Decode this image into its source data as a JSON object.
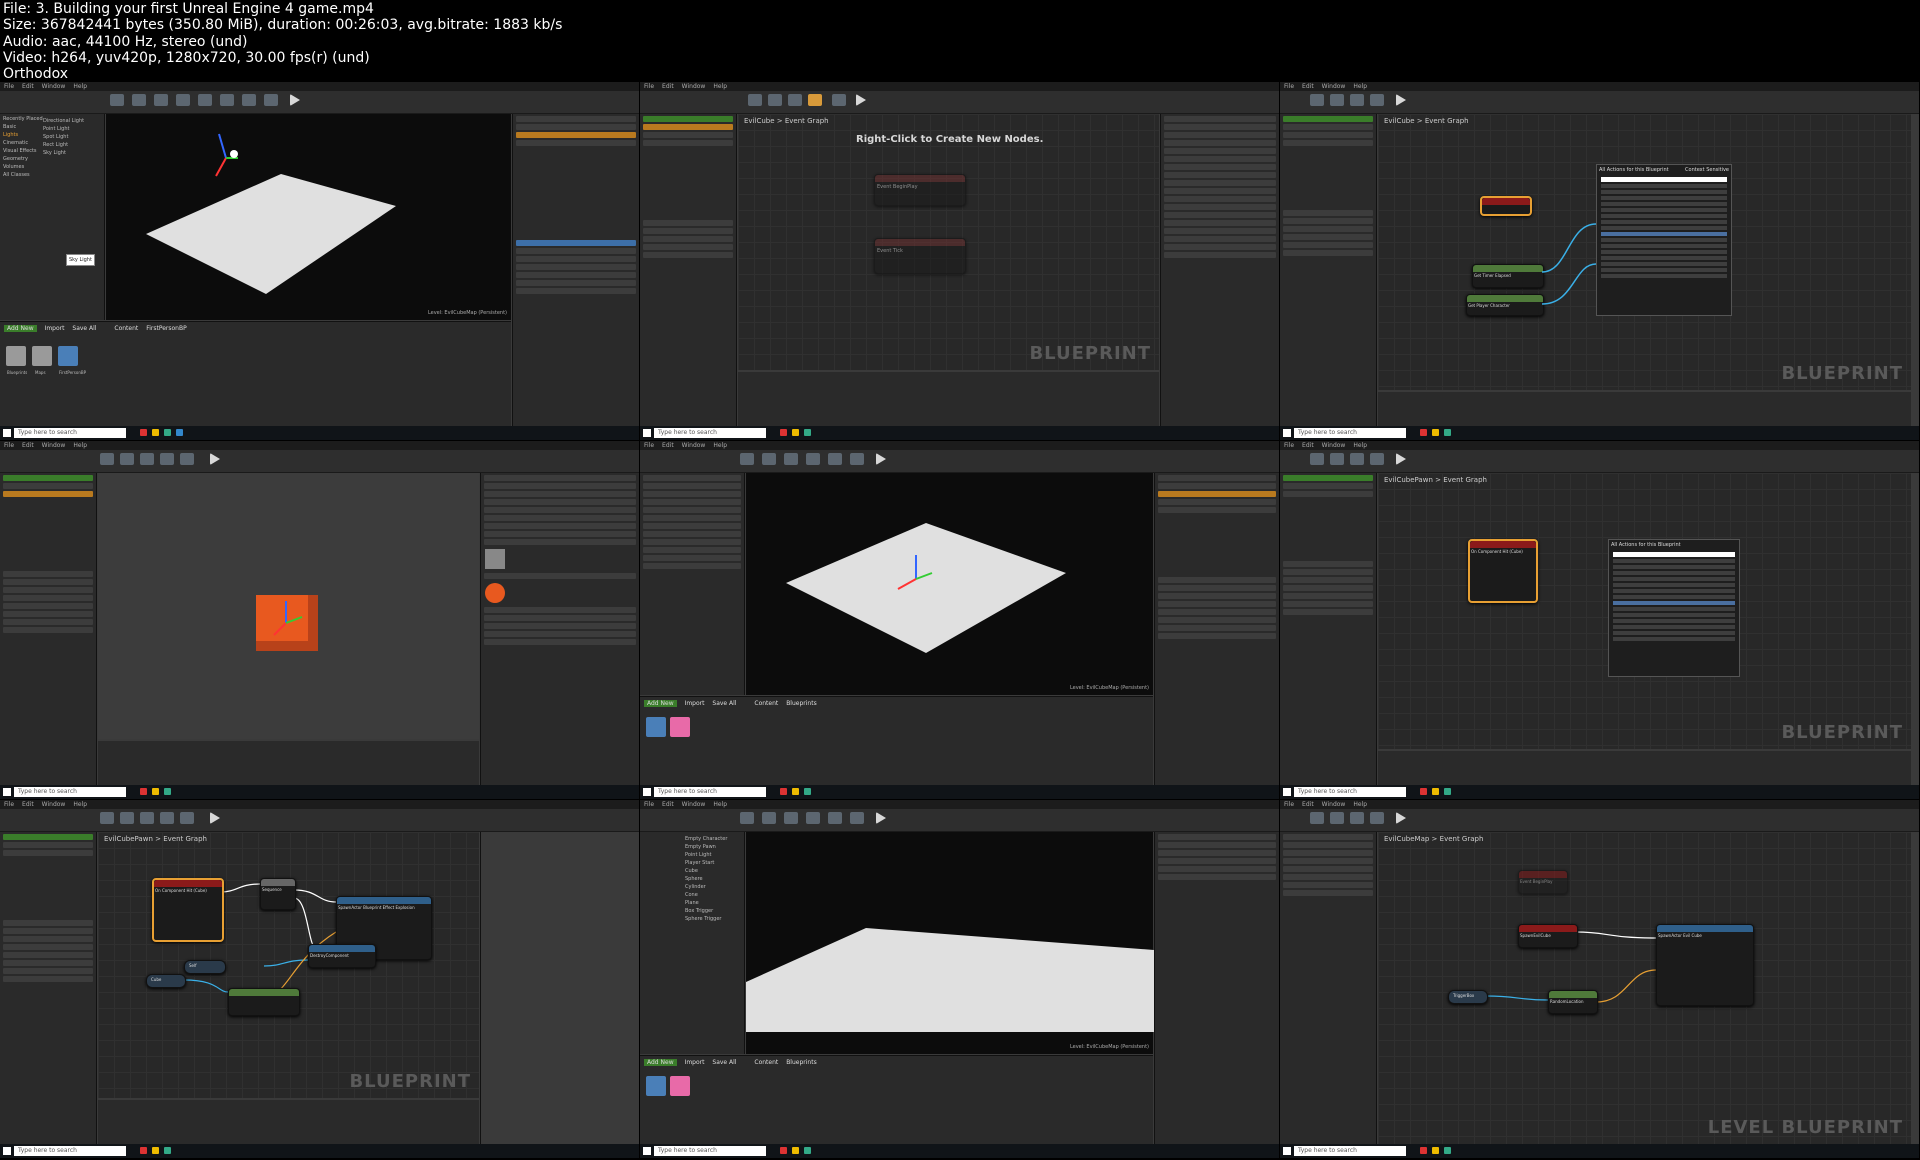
{
  "header": {
    "file": "File: 3. Building your first Unreal Engine 4 game.mp4",
    "size": "Size: 367842441 bytes (350.80 MiB), duration: 00:26:03, avg.bitrate: 1883 kb/s",
    "audio": "Audio: aac, 44100 Hz, stereo (und)",
    "video": "Video: h264, yuv420p, 1280x720, 30.00 fps(r) (und)",
    "author": "Orthodox"
  },
  "common": {
    "menus": [
      "File",
      "Edit",
      "Window",
      "Help"
    ],
    "search_placeholder": "Type here to search",
    "blueprint_watermark": "BLUEPRINT",
    "level_blueprint_watermark": "LEVEL BLUEPRINT",
    "add_new": "Add New",
    "import": "Import",
    "save_all": "Save All",
    "content": "Content",
    "blueprints": "Blueprints",
    "first_person_bp": "FirstPersonBP",
    "event_graph": "Event Graph",
    "add_component": "+ Add Component",
    "details": "Details",
    "components": "Components",
    "my_blueprint": "My Blueprint"
  },
  "cells": {
    "c1": {
      "tooltip": "Sky Light",
      "status": "Level: EvilCubeMap (Persistent)",
      "place_items": [
        "Recently Placed",
        "Basic",
        "Lights",
        "Cinematic",
        "Visual Effects",
        "Geometry",
        "Volumes",
        "All Classes"
      ],
      "light_items": [
        "Directional Light",
        "Point Light",
        "Spot Light",
        "Rect Light",
        "Sky Light"
      ],
      "folders": [
        "Blueprints",
        "Maps",
        "FirstPersonBP"
      ]
    },
    "c2": {
      "title": "EvilCube",
      "hint": "Right-Click to Create New Nodes.",
      "node1": "Event BeginPlay",
      "node2": "Event Tick"
    },
    "c3": {
      "title": "EvilCube",
      "menu_title": "All Actions for this Blueprint",
      "context": "Context Sensitive",
      "node_get_timer": "Get Timer Elapsed",
      "node_get_player": "Get Player Character"
    },
    "c4": {
      "title": "EvilCube",
      "component": "Cube"
    },
    "c5": {
      "status": "Level: EvilCubeMap (Persistent)"
    },
    "c6": {
      "title": "EvilCubePawn",
      "node": "On Component Hit (Cube)",
      "menu_title": "All Actions for this Blueprint"
    },
    "c7": {
      "title": "EvilCubePawn",
      "node_hit": "On Component Hit (Cube)",
      "node_seq": "Sequence",
      "node_spawn": "SpawnActor Blueprint Effect Explosion",
      "node_destroy": "DestroyComponent",
      "node_self": "Self",
      "node_cube": "Cube"
    },
    "c8": {
      "status": "Level: EvilCubeMap (Persistent)",
      "place_items": [
        "Empty Character",
        "Empty Pawn",
        "Point Light",
        "Player Start",
        "Cube",
        "Sphere",
        "Cylinder",
        "Cone",
        "Plane",
        "Box Trigger",
        "Sphere Trigger"
      ]
    },
    "c9": {
      "title": "EvilCubeMap",
      "node_begin": "Event BeginPlay",
      "node_spawn_evil": "SpawnEvilCube",
      "node_spawn_actor": "SpawnActor Evil Cube",
      "node_trigger": "TriggerBox",
      "node_random": "RandomLocation"
    }
  },
  "colors": {
    "header_bg": "#000000",
    "editor_bg": "#3a3a3a",
    "graph_bg": "#282828",
    "event_node": "#8b1a1a",
    "function_node": "#2f5f8a",
    "pure_node": "#4f7a3a",
    "selection": "#e8a033",
    "cube": "#e8591f"
  }
}
